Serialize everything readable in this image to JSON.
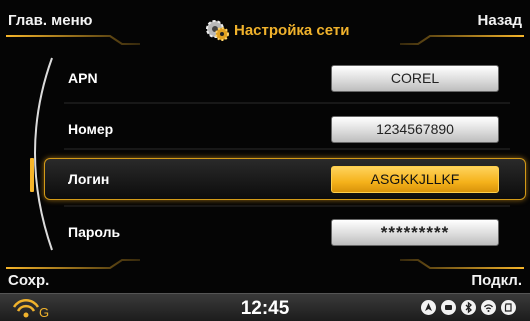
{
  "header": {
    "main_menu_label": "Глав. меню",
    "back_label": "Назад",
    "title": "Настройка сети",
    "title_icon": "gear-icon"
  },
  "footer": {
    "save_label": "Сохр.",
    "connect_label": "Подкл."
  },
  "settings": {
    "rows": [
      {
        "label": "APN",
        "value": "COREL"
      },
      {
        "label": "Номер",
        "value": "1234567890"
      },
      {
        "label": "Логин",
        "value": "ASGKKJLLKF",
        "selected": true
      },
      {
        "label": "Пароль",
        "value": "*********"
      }
    ]
  },
  "status_bar": {
    "time": "12:45",
    "signal_icon": "signal-g-icon",
    "signal_letter": "G",
    "icons": [
      "navigation-icon",
      "message-icon",
      "bluetooth-icon",
      "wifi-icon",
      "sd-card-icon"
    ]
  },
  "colors": {
    "accent": "#f0b22c",
    "selected_field": "#f5b21b",
    "field": "#e8e8e8",
    "background": "#050505"
  }
}
